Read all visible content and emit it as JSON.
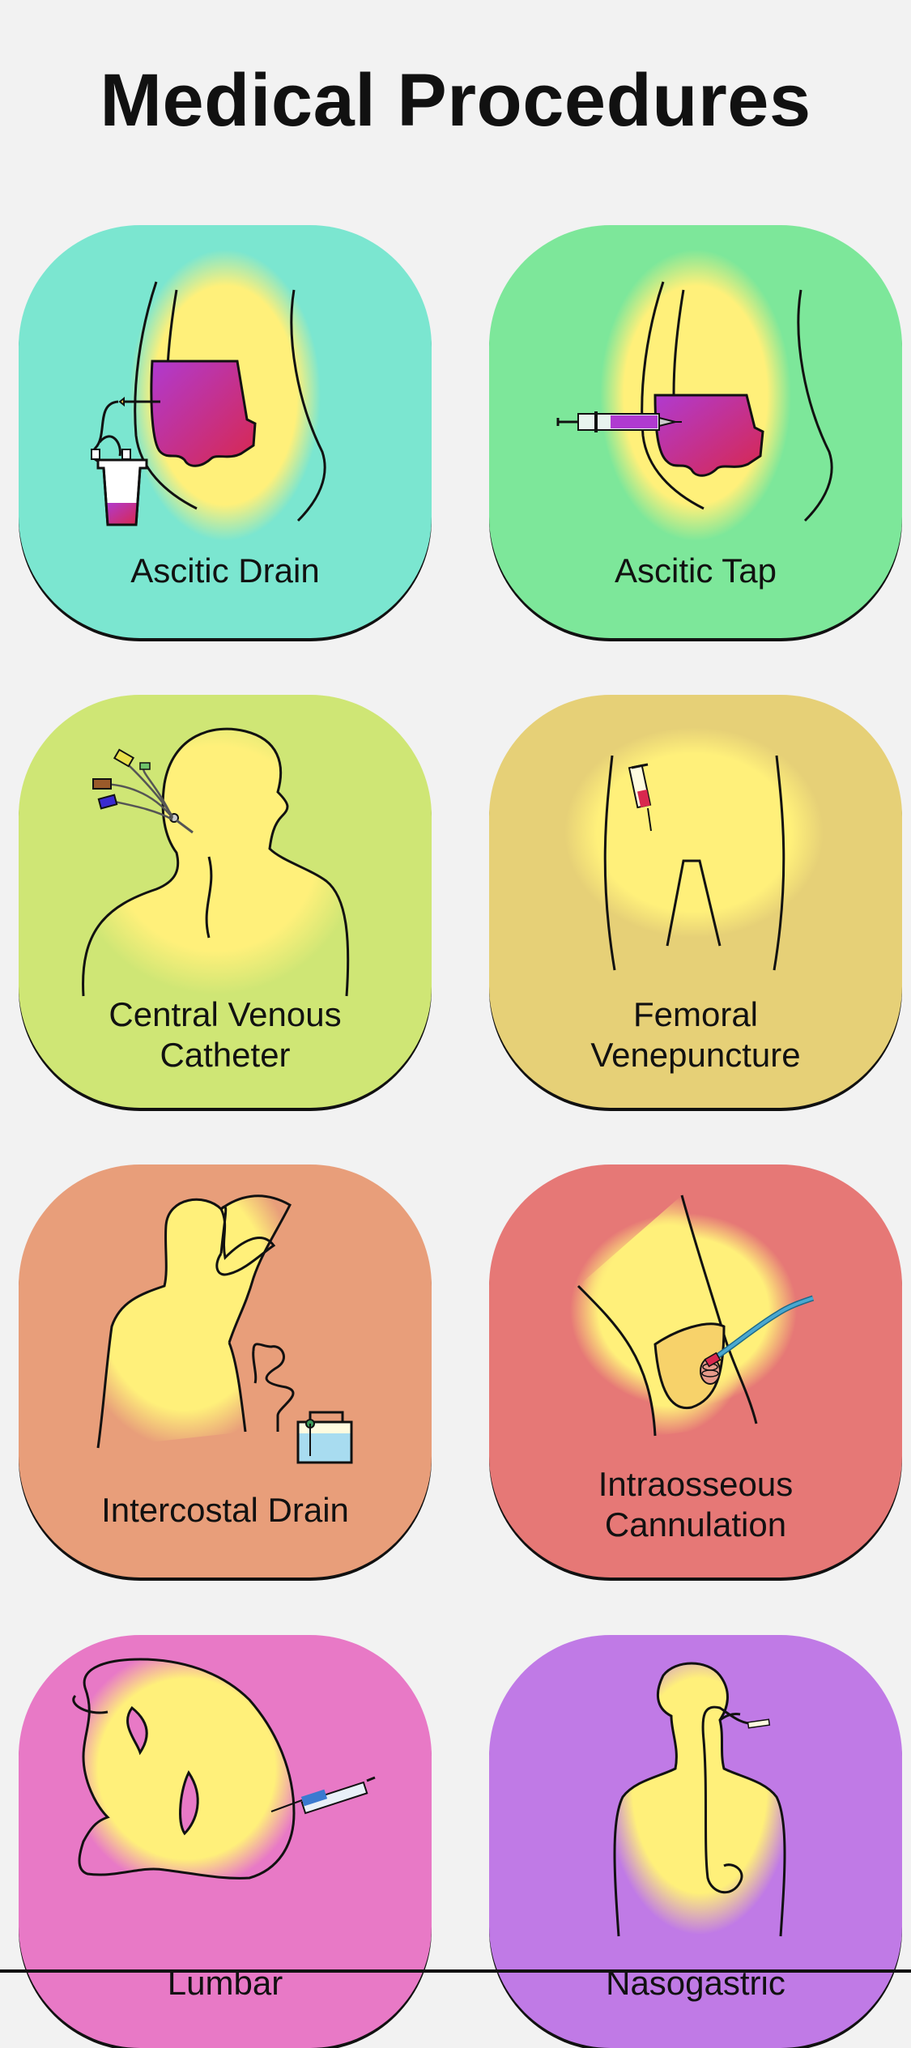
{
  "page": {
    "title": "Medical Procedures"
  },
  "procedures": [
    {
      "label": "Ascitic Drain",
      "color": "#7be6d0",
      "icon": "ascitic-drain-icon"
    },
    {
      "label": "Ascitic Tap",
      "color": "#7de79a",
      "icon": "ascitic-tap-icon"
    },
    {
      "label": "Central Venous Catheter",
      "line1": "Central Venous",
      "line2": "Catheter",
      "color": "#cfe675",
      "icon": "central-venous-catheter-icon"
    },
    {
      "label": "Femoral Venepuncture",
      "line1": "Femoral",
      "line2": "Venepuncture",
      "color": "#e6d077",
      "icon": "femoral-venepuncture-icon"
    },
    {
      "label": "Intercostal Drain",
      "color": "#e89e7a",
      "icon": "intercostal-drain-icon"
    },
    {
      "label": "Intraosseous Cannulation",
      "line1": "Intraosseous",
      "line2": "Cannulation",
      "color": "#e67876",
      "icon": "intraosseous-cannulation-icon"
    },
    {
      "label": "Lumbar",
      "color": "#e879c6",
      "icon": "lumbar-puncture-icon"
    },
    {
      "label": "Nasogastric",
      "color": "#c07ae6",
      "icon": "nasogastric-tube-icon"
    }
  ],
  "colors": {
    "skin": "#fff07a",
    "fluid_start": "#b03ad0",
    "fluid_end": "#d8284e",
    "outline": "#111111"
  }
}
